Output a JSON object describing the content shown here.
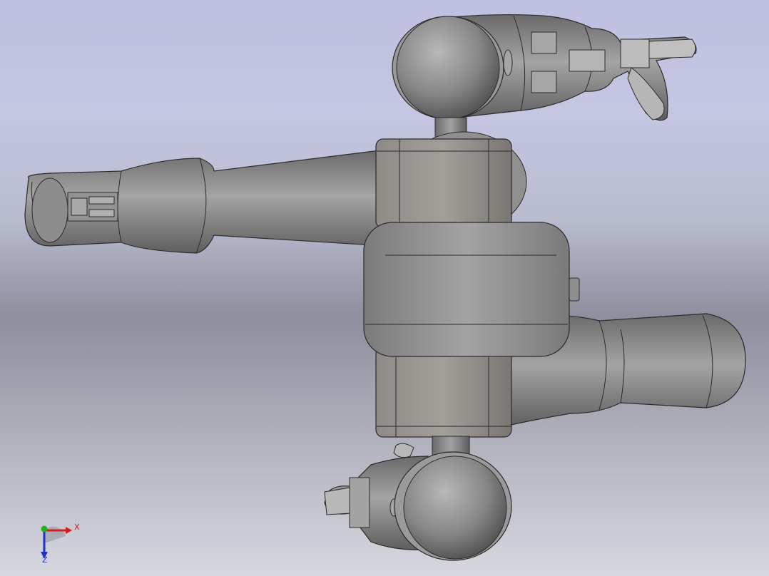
{
  "viewport": {
    "model": "robot-assembly-top-view",
    "background_colors": [
      "#bfc0e0",
      "#8d8f9e",
      "#d6d7df"
    ],
    "part_color": "#8a8a8a"
  },
  "triad": {
    "x_label": "X",
    "z_label": "Z",
    "x_color": "#d22020",
    "y_color": "#20b020",
    "z_color": "#2030c8"
  }
}
